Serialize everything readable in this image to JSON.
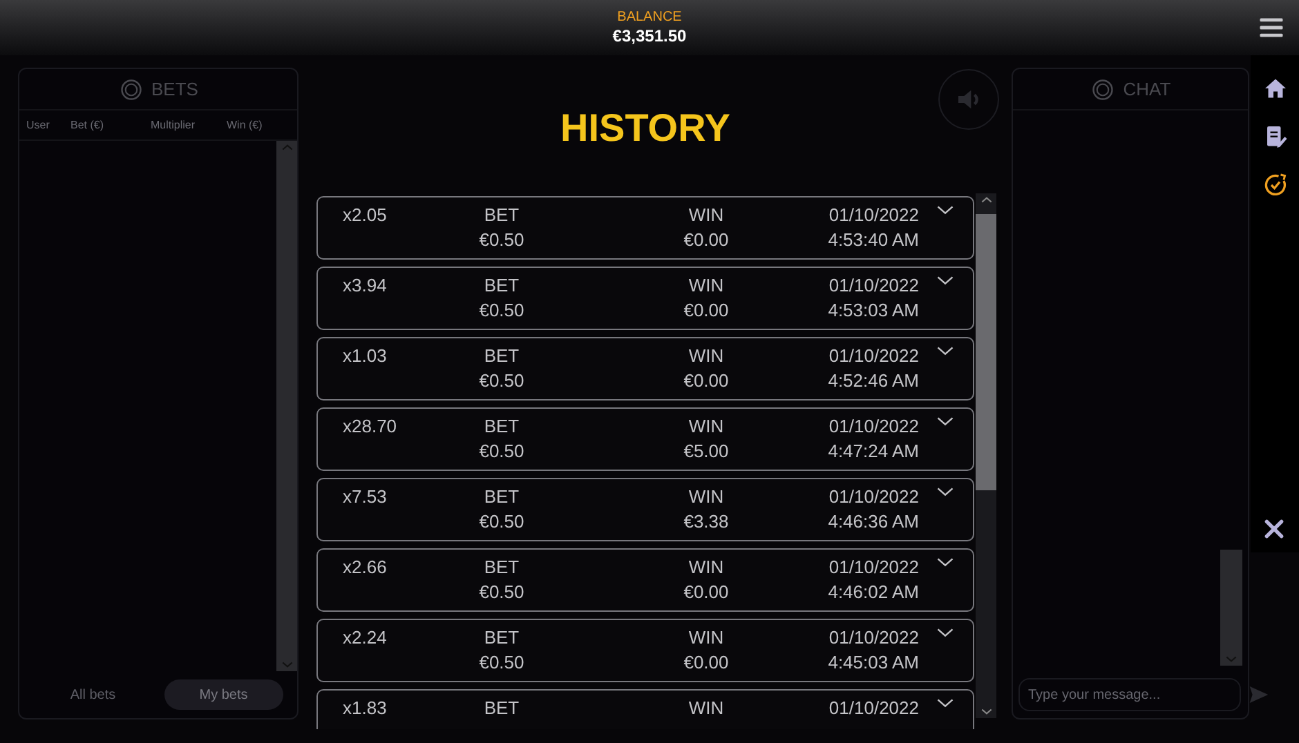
{
  "top_bar": {
    "balance_label": "BALANCE",
    "balance": "€3,351.50"
  },
  "bets_panel": {
    "title": "BETS",
    "columns": [
      "User",
      "Bet (€)",
      "Multiplier",
      "Win (€)"
    ],
    "tabs": [
      {
        "label": "All bets",
        "selected": false
      },
      {
        "label": "My bets",
        "selected": true
      }
    ]
  },
  "chat_panel": {
    "title": "CHAT",
    "placeholder": "Type your message..."
  },
  "history": {
    "title": "HISTORY",
    "rows": [
      {
        "multiplier": "x2.05",
        "bet_label": "BET",
        "bet": "€0.50",
        "win_label": "WIN",
        "win": "€0.00",
        "date": "01/10/2022",
        "time": "4:53:40 AM"
      },
      {
        "multiplier": "x3.94",
        "bet_label": "BET",
        "bet": "€0.50",
        "win_label": "WIN",
        "win": "€0.00",
        "date": "01/10/2022",
        "time": "4:53:03 AM"
      },
      {
        "multiplier": "x1.03",
        "bet_label": "BET",
        "bet": "€0.50",
        "win_label": "WIN",
        "win": "€0.00",
        "date": "01/10/2022",
        "time": "4:52:46 AM"
      },
      {
        "multiplier": "x28.70",
        "bet_label": "BET",
        "bet": "€0.50",
        "win_label": "WIN",
        "win": "€5.00",
        "date": "01/10/2022",
        "time": "4:47:24 AM"
      },
      {
        "multiplier": "x7.53",
        "bet_label": "BET",
        "bet": "€0.50",
        "win_label": "WIN",
        "win": "€3.38",
        "date": "01/10/2022",
        "time": "4:46:36 AM"
      },
      {
        "multiplier": "x2.66",
        "bet_label": "BET",
        "bet": "€0.50",
        "win_label": "WIN",
        "win": "€0.00",
        "date": "01/10/2022",
        "time": "4:46:02 AM"
      },
      {
        "multiplier": "x2.24",
        "bet_label": "BET",
        "bet": "€0.50",
        "win_label": "WIN",
        "win": "€0.00",
        "date": "01/10/2022",
        "time": "4:45:03 AM"
      },
      {
        "multiplier": "x1.83",
        "bet_label": "BET",
        "win_label": "WIN",
        "date": "01/10/2022"
      }
    ]
  }
}
